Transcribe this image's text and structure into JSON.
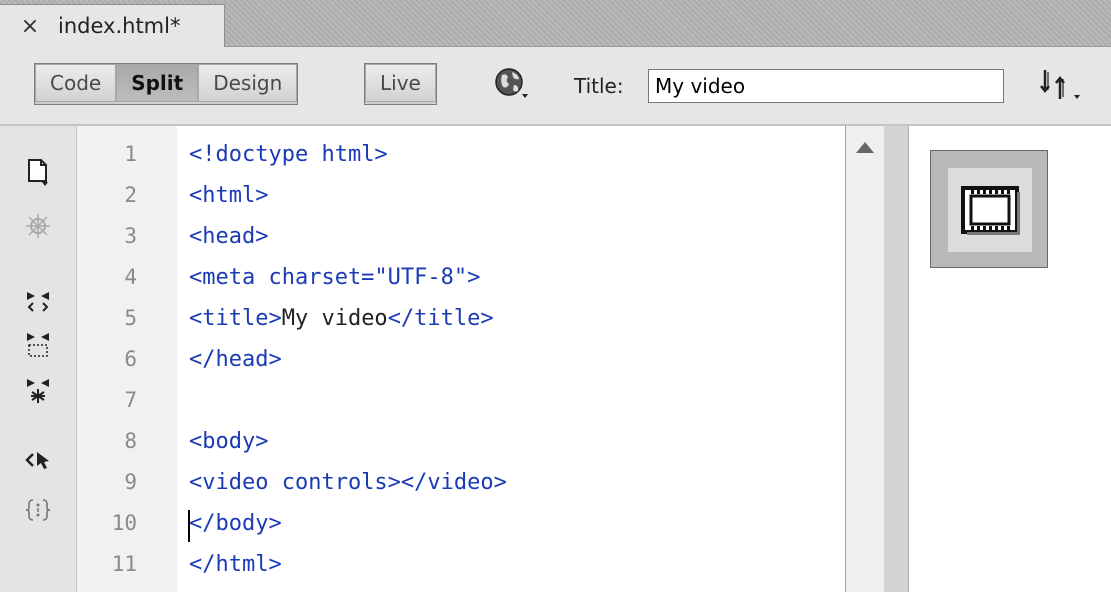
{
  "tab": {
    "close_label": "×",
    "filename": "index.html*"
  },
  "toolbar": {
    "views": [
      {
        "label": "Code",
        "active": false
      },
      {
        "label": "Split",
        "active": true
      },
      {
        "label": "Design",
        "active": false
      },
      {
        "label": "Live",
        "active": false
      }
    ],
    "preview_icon": "globe-icon",
    "title_label": "Title:",
    "title_value": "My video",
    "sync_icon": "file-management-icon"
  },
  "gutter_icons": [
    "open-documents-icon",
    "bug-icon",
    "collapse-tag-icon",
    "collapse-selection-icon",
    "expand-all-icon",
    "select-parent-tag-icon",
    "balance-braces-icon"
  ],
  "code": {
    "lines": [
      {
        "num": "1",
        "text": "<!doctype html>"
      },
      {
        "num": "2",
        "text": "<html>"
      },
      {
        "num": "3",
        "text": "<head>"
      },
      {
        "num": "4",
        "text": "<meta charset=\"UTF-8\">"
      },
      {
        "num": "5",
        "open": "<title>",
        "content": "My video",
        "close": "</title>"
      },
      {
        "num": "6",
        "text": "</head>"
      },
      {
        "num": "7",
        "text": ""
      },
      {
        "num": "8",
        "text": "<body>"
      },
      {
        "num": "9",
        "text": "<video controls></video>"
      },
      {
        "num": "10",
        "text": "</body>"
      },
      {
        "num": "11",
        "text": "</html>"
      }
    ]
  },
  "design_pane": {
    "placeholder_icon": "video-placeholder-icon"
  },
  "colors": {
    "tag": "#1b3bb5",
    "active_button": "#b3b3b3"
  }
}
